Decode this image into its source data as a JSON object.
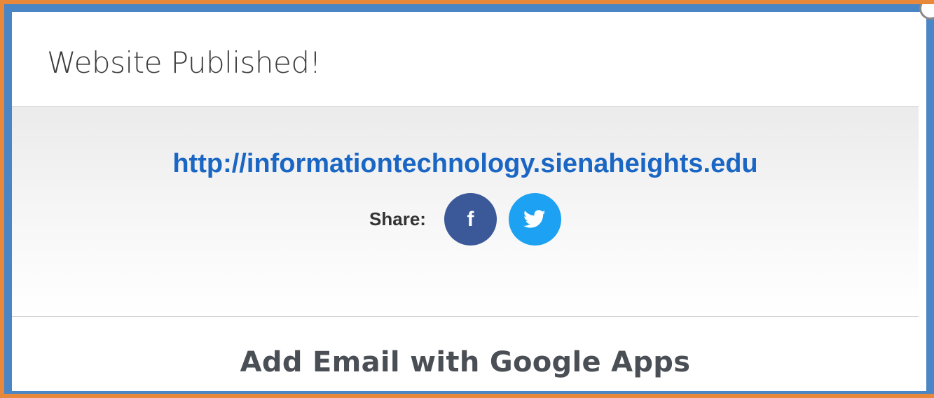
{
  "dialog": {
    "title": "Website Published!",
    "url": "http://informationtechnology.sienaheights.edu",
    "share_label": "Share:",
    "social": [
      {
        "name": "facebook",
        "glyph": "f",
        "color": "#3b5998"
      },
      {
        "name": "twitter",
        "icon": "twitter-bird-icon",
        "color": "#1da1f2"
      }
    ],
    "footer_title": "Add Email with Google Apps"
  },
  "colors": {
    "outer_border": "#e8883a",
    "inner_border": "#4a86c5",
    "link": "#1a66c4"
  }
}
